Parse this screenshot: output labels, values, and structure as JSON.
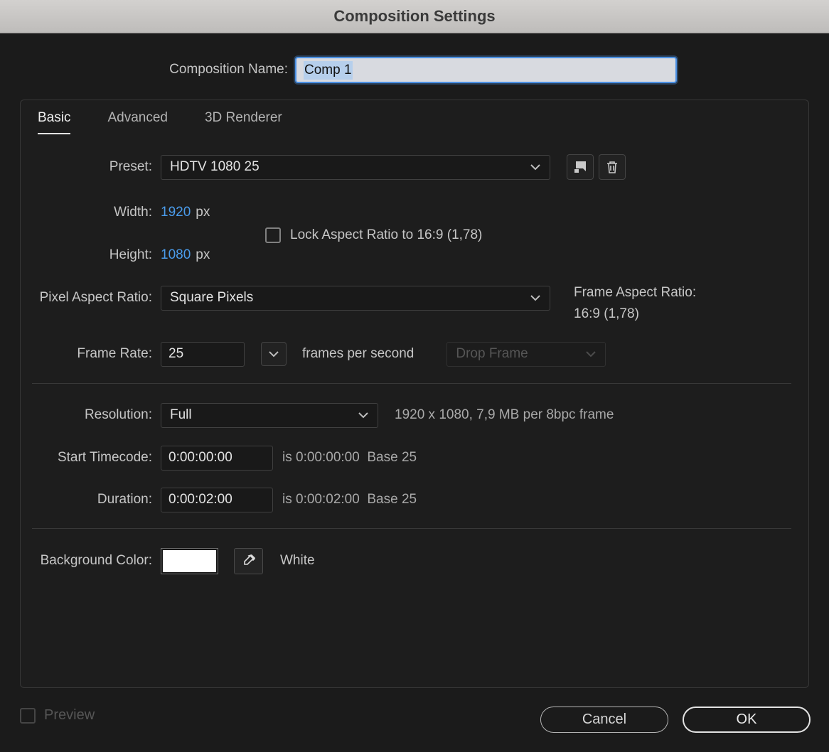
{
  "window": {
    "title": "Composition Settings"
  },
  "name_row": {
    "label": "Composition Name:",
    "value": "Comp 1"
  },
  "tabs": {
    "basic": "Basic",
    "advanced": "Advanced",
    "renderer": "3D Renderer"
  },
  "preset": {
    "label": "Preset:",
    "value": "HDTV 1080 25"
  },
  "dimensions": {
    "width_label": "Width:",
    "width_value": "1920",
    "width_unit": "px",
    "height_label": "Height:",
    "height_value": "1080",
    "height_unit": "px",
    "lock_label": "Lock Aspect Ratio to 16:9 (1,78)",
    "lock_checked": false
  },
  "pixel_aspect": {
    "label": "Pixel Aspect Ratio:",
    "value": "Square Pixels",
    "frame_aspect_label": "Frame Aspect Ratio:",
    "frame_aspect_value": "16:9 (1,78)"
  },
  "frame_rate": {
    "label": "Frame Rate:",
    "value": "25",
    "suffix": "frames per second",
    "drop_frame": "Drop Frame"
  },
  "resolution": {
    "label": "Resolution:",
    "value": "Full",
    "info": "1920 x 1080, 7,9 MB per 8bpc frame"
  },
  "start_timecode": {
    "label": "Start Timecode:",
    "value": "0:00:00:00",
    "info": "is 0:00:00:00  Base 25"
  },
  "duration": {
    "label": "Duration:",
    "value": "0:00:02:00",
    "info": "is 0:00:02:00  Base 25"
  },
  "background": {
    "label": "Background Color:",
    "color_hex": "#ffffff",
    "color_name": "White"
  },
  "footer": {
    "preview": "Preview",
    "cancel": "Cancel",
    "ok": "OK"
  },
  "colors": {
    "value_blue": "#4a9bea",
    "selection_blue": "#b6cfec",
    "focus_border": "#4a8fe2"
  }
}
